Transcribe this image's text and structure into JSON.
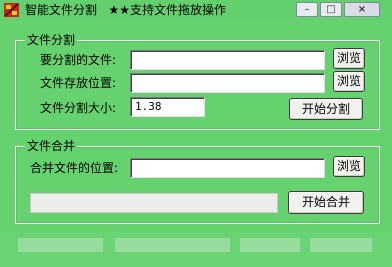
{
  "window": {
    "title": "智能文件分割",
    "subtitle": "★★支持文件拖放操作",
    "minimize_symbol": "–",
    "maximize_symbol": "□",
    "close_symbol": "×"
  },
  "split_group": {
    "legend": "文件分割",
    "source_label": "要分割的文件:",
    "source_value": "",
    "dest_label": "文件存放位置:",
    "dest_value": "",
    "size_label": "文件分割大小:",
    "size_value": "1.38",
    "browse_label": "浏览",
    "start_label": "开始分割"
  },
  "merge_group": {
    "legend": "文件合并",
    "location_label": "合并文件的位置:",
    "location_value": "",
    "browse_label": "浏览",
    "start_label": "开始合并",
    "progress": 0
  },
  "colors": {
    "background": "#65d16f",
    "text": "#000000"
  }
}
